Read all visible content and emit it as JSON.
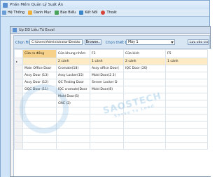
{
  "app": {
    "title": "Phần Mềm Quản Lý Suất Ăn"
  },
  "menu": [
    {
      "label": "Hệ Thống",
      "icon": "system-icon"
    },
    {
      "label": "Danh Mục",
      "icon": "category-icon"
    },
    {
      "label": "Báo Biểu",
      "icon": "report-icon"
    },
    {
      "label": "Kết Nối",
      "icon": "connect-icon"
    },
    {
      "label": "Thoát",
      "icon": "exit-icon"
    }
  ],
  "dialog": {
    "title": "Up DD Liêu Từ Excel",
    "file_label": "Chọn File",
    "file_path": "C:\\Users\\Administrator\\Deskto",
    "browse_label": "Browse..",
    "sheet_label": "Chọn thiết bị",
    "sheet_value": "Máy 1",
    "save_label": "Lưu vào csdl"
  },
  "grid": {
    "headers": [
      "Cửa ra đổng",
      "Cửa khung nhôm",
      "F3",
      "Cửa kính",
      "F5"
    ],
    "rows": [
      {
        "marker": "▸",
        "cells": [
          "",
          "2 cánh",
          "1 cánh",
          "2 cánh",
          "1 cánh"
        ]
      },
      {
        "marker": "",
        "cells": [
          "Main Office Door",
          "Cromate(18)",
          "Assy office Door(",
          "IQC Door (20)",
          ""
        ]
      },
      {
        "marker": "",
        "cells": [
          "Assy Door (13)",
          "Assy Locker(15)",
          "Mold Door(2 3)",
          "",
          ""
        ]
      },
      {
        "marker": "",
        "cells": [
          "Assy Door (12)",
          "QC  Testing Door",
          "Server Locker  D",
          "",
          ""
        ]
      },
      {
        "marker": "",
        "cells": [
          "OQC Door (11)",
          "IQC cromate(Door",
          "Mold Door(8)",
          "",
          ""
        ]
      },
      {
        "marker": "",
        "cells": [
          "",
          "Mold Door(5)",
          "",
          "",
          ""
        ]
      },
      {
        "marker": "",
        "cells": [
          "",
          "CNC (2)",
          "",
          "",
          ""
        ]
      }
    ]
  },
  "watermark": {
    "text": "SAOSTECH",
    "sub": "Serve to Lead"
  }
}
